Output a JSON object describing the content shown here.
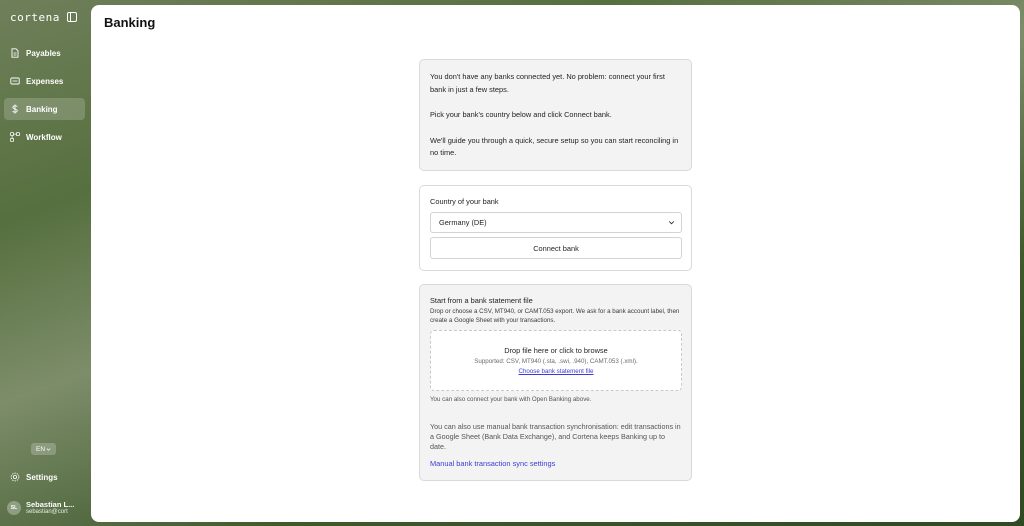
{
  "app": {
    "brand": "cortena"
  },
  "sidebar": {
    "items": [
      {
        "label": "Payables",
        "icon": "document-icon"
      },
      {
        "label": "Expenses",
        "icon": "receipt-icon"
      },
      {
        "label": "Banking",
        "icon": "dollar-icon",
        "active": true
      },
      {
        "label": "Workflow",
        "icon": "workflow-icon"
      }
    ],
    "language": "EN",
    "settings_label": "Settings",
    "user": {
      "initials": "SL",
      "name": "Sebastian L...",
      "email": "sebastian@cort"
    }
  },
  "main": {
    "title": "Banking",
    "intro": {
      "line1": "You don't have any banks connected yet. No problem: connect your first bank in just a few steps.",
      "line2": "Pick your bank's country below and click Connect bank.",
      "line3": "We'll guide you through a quick, secure setup so you can start reconciling in no time."
    },
    "country": {
      "label": "Country of your bank",
      "selected": "Germany (DE)",
      "connect_label": "Connect bank"
    },
    "statement": {
      "title": "Start from a bank statement file",
      "description": "Drop or choose a CSV, MT940, or CAMT.053 export. We ask for a bank account label, then create a Google Sheet with your transactions.",
      "drop_title": "Drop file here or click to browse",
      "supported": "Supported: CSV, MT940 (.sta, .swi, .940), CAMT.053 (.xml).",
      "choose_link": "Choose bank statement file",
      "open_banking_note": "You can also connect your bank with Open Banking above.",
      "manual_text": "You can also use manual bank transaction synchronisation: edit transactions in a Google Sheet (Bank Data Exchange), and Cortena keeps Banking up to date.",
      "manual_link": "Manual bank transaction sync settings"
    }
  },
  "colors": {
    "accent_link": "#3b3bd6",
    "card_bg": "#f3f3f3",
    "sidebar_bg": "#56703f"
  }
}
